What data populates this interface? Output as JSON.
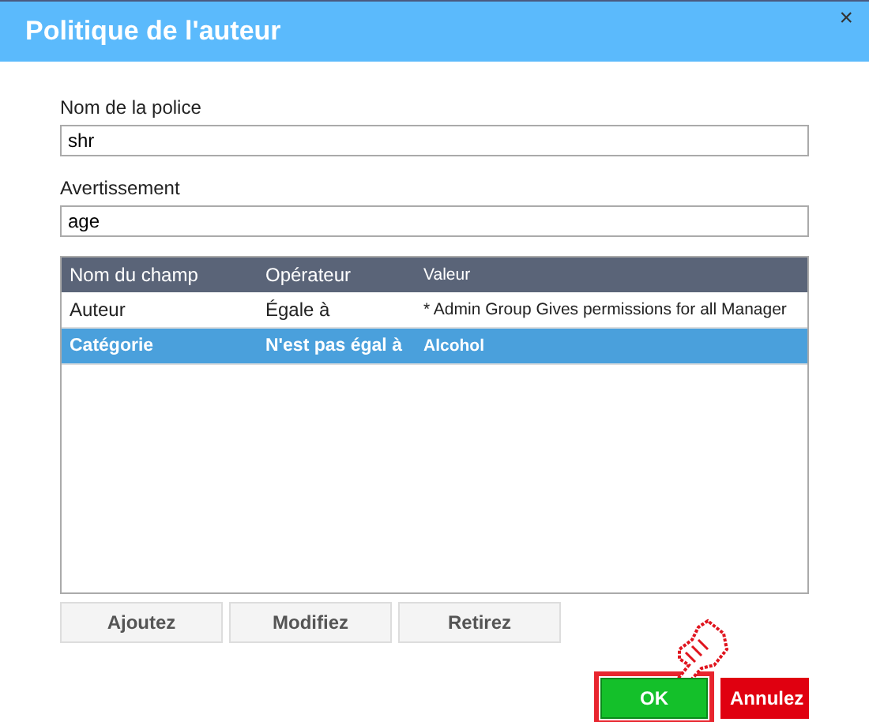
{
  "window": {
    "title": "Politique de l'auteur",
    "close": "×"
  },
  "fields": [
    {
      "label": "Nom de la police",
      "value": "shr"
    },
    {
      "label": "Avertissement",
      "value": "age"
    }
  ],
  "table": {
    "columns": [
      "Nom du champ",
      "Opérateur",
      "Valeur"
    ],
    "rows": [
      {
        "cells": [
          "Auteur",
          "Égale à",
          "* Admin Group Gives permissions for all Manager"
        ],
        "selected": false
      },
      {
        "cells": [
          "Catégorie",
          "N'est pas égal à",
          "Alcohol"
        ],
        "selected": true
      }
    ]
  },
  "row_buttons": [
    "Ajoutez",
    "Modifiez",
    "Retirez"
  ],
  "ok_button": {
    "label": "OK",
    "highlighted": true
  },
  "cancel_button": "Annulez"
}
